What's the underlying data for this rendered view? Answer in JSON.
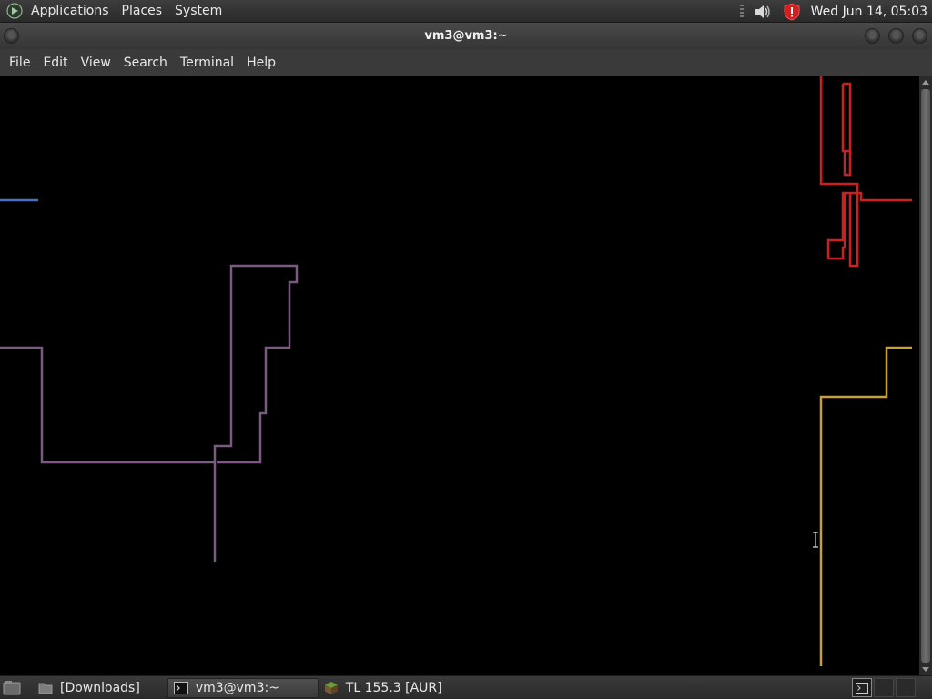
{
  "top_panel": {
    "menus": [
      "Applications",
      "Places",
      "System"
    ],
    "clock": "Wed Jun 14, 05:03",
    "tray_icons": [
      "volume-icon",
      "update-shield-icon"
    ]
  },
  "window": {
    "title": "vm3@vm3:~"
  },
  "menubar": {
    "items": [
      "File",
      "Edit",
      "View",
      "Search",
      "Terminal",
      "Help"
    ]
  },
  "terminal": {
    "background": "#000000",
    "trails": [
      {
        "color": "#4a6fc4"
      },
      {
        "color": "#7b5a80"
      },
      {
        "color": "#cc1f1f"
      },
      {
        "color": "#c8a030"
      }
    ]
  },
  "taskbar": {
    "tasks": [
      {
        "label": "[Downloads]",
        "icon": "folder-icon",
        "active": false
      },
      {
        "label": "vm3@vm3:~",
        "icon": "terminal-icon",
        "active": true
      },
      {
        "label": "TL 155.3 [AUR]",
        "icon": "game-block-icon",
        "active": false
      }
    ]
  }
}
